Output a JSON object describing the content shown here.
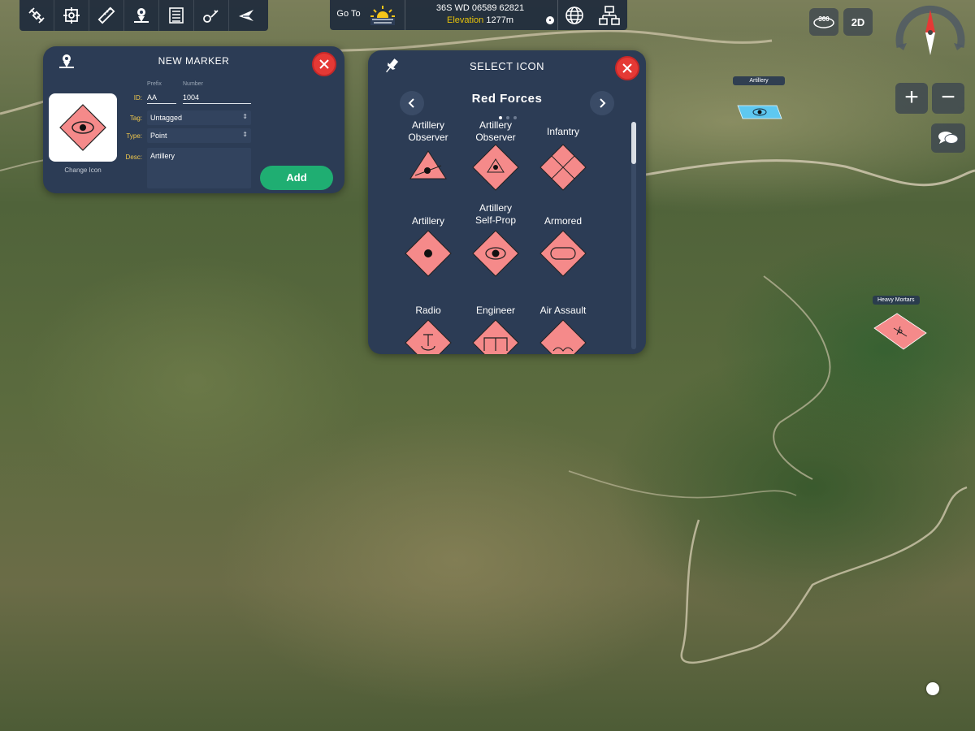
{
  "toolbar": {
    "left_tools": [
      {
        "icon": "satellite-icon"
      },
      {
        "icon": "crosshair-target-icon"
      },
      {
        "icon": "ruler-icon"
      },
      {
        "icon": "add-marker-icon"
      },
      {
        "icon": "list-icon"
      },
      {
        "icon": "draw-tools-icon"
      },
      {
        "icon": "aircraft-icon"
      }
    ],
    "goto_label": "Go To",
    "coordinate": "36S WD 06589 62821",
    "elevation_label": "Elevation",
    "elevation_value": "1277m"
  },
  "view_controls": {
    "mode_3d_label": "360",
    "mode_2d_label": "2D",
    "zoom_in": "+",
    "zoom_out": "−"
  },
  "new_marker_panel": {
    "title": "NEW MARKER",
    "change_icon_label": "Change Icon",
    "id_label": "ID:",
    "prefix_label": "Prefix",
    "number_label": "Number",
    "prefix_value": "AA",
    "number_value": "1004",
    "tag_label": "Tag:",
    "tag_value": "Untagged",
    "type_label": "Type:",
    "type_value": "Point",
    "desc_label": "Desc:",
    "desc_value": "Artillery",
    "add_button": "Add"
  },
  "select_icon_panel": {
    "title": "SELECT ICON",
    "category": "Red Forces",
    "page_count": 3,
    "active_page": 1,
    "icons": [
      {
        "label": "Artillery\nObserver",
        "symbol": "observer-triangle-dot"
      },
      {
        "label": "Artillery\nObserver",
        "symbol": "observer-diamond"
      },
      {
        "label": "Infantry",
        "symbol": "infantry-cross"
      },
      {
        "label": "Artillery",
        "symbol": "artillery-dot"
      },
      {
        "label": "Artillery\nSelf-Prop",
        "symbol": "self-propelled"
      },
      {
        "label": "Armored",
        "symbol": "armored-oval"
      },
      {
        "label": "Radio",
        "symbol": "radio"
      },
      {
        "label": "Engineer",
        "symbol": "engineer"
      },
      {
        "label": "Air Assault",
        "symbol": "air-assault"
      }
    ]
  },
  "map_markers": [
    {
      "label": "Artillery",
      "color": "#5ec8f0"
    },
    {
      "label": "Heavy Mortars",
      "color": "#f58a8a"
    }
  ],
  "colors": {
    "panel_bg": "#2c3c55",
    "hostile_fill": "#f58a8a",
    "friendly_fill": "#5ec8f0",
    "add_button": "#1fae72",
    "close_button": "#e53935",
    "elevation_label": "#e6c20a"
  }
}
